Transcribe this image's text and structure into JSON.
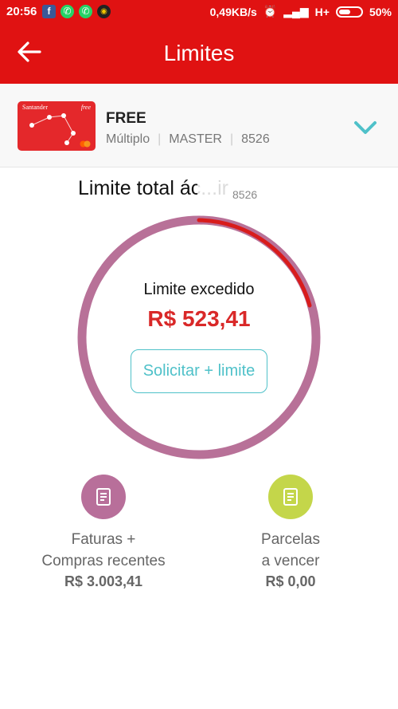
{
  "status_bar": {
    "time": "20:56",
    "network_speed": "0,49KB/s",
    "network_type": "H+",
    "battery": "50%",
    "apps": [
      "facebook-icon",
      "whatsapp-icon",
      "whatsapp-icon",
      "camera-icon"
    ]
  },
  "header": {
    "title": "Limites",
    "back_icon": "arrow-left-icon"
  },
  "card": {
    "name": "FREE",
    "type": "Múltiplo",
    "brand": "MASTER",
    "last_digits": "8526",
    "card_brand_text": "Santander",
    "card_tier_text": "free"
  },
  "limit": {
    "title": "Limite total ác...ir",
    "subtitle": "8526",
    "status": "Limite excedido",
    "value": "R$ 523,41",
    "request_button": "Solicitar + limite"
  },
  "summary": {
    "left": {
      "label_line1": "Faturas +",
      "label_line2": "Compras recentes",
      "value": "R$ 3.003,41",
      "icon": "document-icon"
    },
    "right": {
      "label_line1": "Parcelas",
      "label_line2": "a vencer",
      "value": "R$ 0,00",
      "icon": "document-icon"
    }
  },
  "colors": {
    "brand_red": "#e01212",
    "ring": "#b87198",
    "ring_exceeded": "#d81c1c",
    "accent_teal": "#4fc1c9",
    "icon_green": "#c4d64a"
  }
}
